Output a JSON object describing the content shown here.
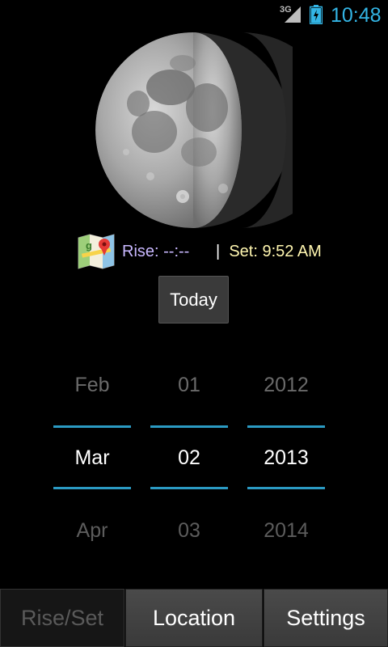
{
  "status_bar": {
    "network_type": "3G",
    "time": "10:48",
    "clock_color": "#33b5e5"
  },
  "moon": {
    "phase_name": "waning-gibbous-icon"
  },
  "rise_set": {
    "rise": "Rise: --:--",
    "separator": "|",
    "set": "Set: 9:52 AM",
    "rise_color": "#c9b8ff",
    "set_color": "#fff6b0"
  },
  "today_button": "Today",
  "date_picker": {
    "month": {
      "prev": "Feb",
      "current": "Mar",
      "next": "Apr"
    },
    "day": {
      "prev": "01",
      "current": "02",
      "next": "03"
    },
    "year": {
      "prev": "2012",
      "current": "2013",
      "next": "2014"
    },
    "accent": "#33b5e5"
  },
  "tabs": {
    "riseset": "Rise/Set",
    "location": "Location",
    "settings": "Settings"
  }
}
